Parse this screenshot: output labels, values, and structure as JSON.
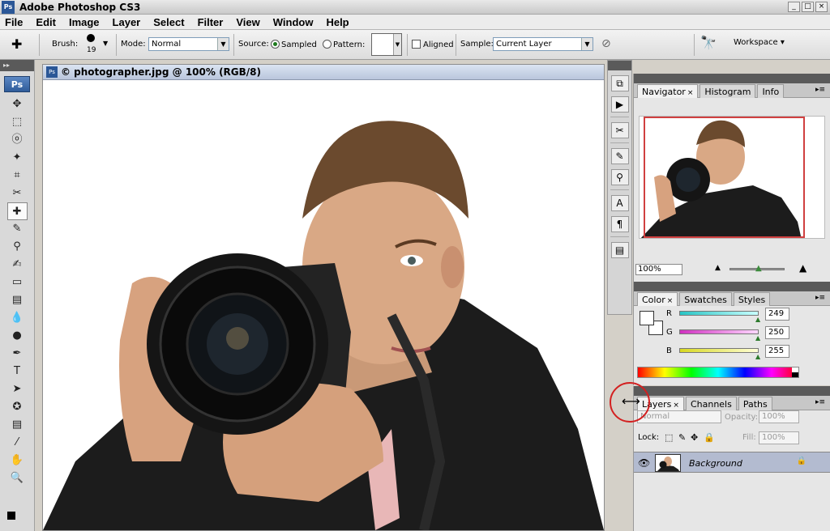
{
  "app": {
    "title": "Adobe Photoshop CS3",
    "logo": "Ps",
    "window_buttons": [
      "_",
      "□",
      "×"
    ]
  },
  "menu": [
    "File",
    "Edit",
    "Image",
    "Layer",
    "Select",
    "Filter",
    "View",
    "Window",
    "Help"
  ],
  "options": {
    "brush_label": "Brush:",
    "brush_size": "19",
    "mode_label": "Mode:",
    "mode_value": "Normal",
    "source_label": "Source:",
    "sampled_label": "Sampled",
    "pattern_label": "Pattern:",
    "aligned_label": "Aligned",
    "sample_label": "Sample:",
    "sample_value": "Current Layer",
    "workspace_label": "Workspace ▾"
  },
  "document": {
    "title": "© photographer.jpg @ 100% (RGB/8)"
  },
  "navigator": {
    "tabs": [
      "Navigator",
      "Histogram",
      "Info"
    ],
    "zoom": "100%"
  },
  "color": {
    "tabs": [
      "Color",
      "Swatches",
      "Styles"
    ],
    "channels": [
      {
        "label": "R",
        "value": "249",
        "color": "#28c4c4"
      },
      {
        "label": "G",
        "value": "250",
        "color": "#d030c0"
      },
      {
        "label": "B",
        "value": "255",
        "color": "#d8d820"
      }
    ]
  },
  "layers": {
    "tabs": [
      "Layers",
      "Channels",
      "Paths"
    ],
    "blend_mode": "Normal",
    "opacity_label": "Opacity:",
    "opacity_value": "100%",
    "lock_label": "Lock:",
    "fill_label": "Fill:",
    "fill_value": "100%",
    "layer_name": "Background"
  },
  "toolbox": {
    "logo": "Ps",
    "tools": [
      "move-tool",
      "marquee-tool",
      "lasso-tool",
      "magic-wand-tool",
      "crop-tool",
      "slice-tool",
      "healing-brush-tool",
      "brush-tool",
      "clone-stamp-tool",
      "history-brush-tool",
      "eraser-tool",
      "gradient-tool",
      "blur-tool",
      "dodge-tool",
      "pen-tool",
      "type-tool",
      "path-selection-tool",
      "shape-tool",
      "notes-tool",
      "eyedropper-tool",
      "hand-tool",
      "zoom-tool"
    ],
    "glyphs": [
      "✥",
      "⬚",
      "ⓞ",
      "✦",
      "⌗",
      "✂",
      "✚",
      "✎",
      "⚲",
      "✍",
      "▭",
      "▤",
      "💧",
      "●",
      "✒",
      "T",
      "➤",
      "✪",
      "▤",
      "⁄",
      "✋",
      "🔍"
    ]
  }
}
